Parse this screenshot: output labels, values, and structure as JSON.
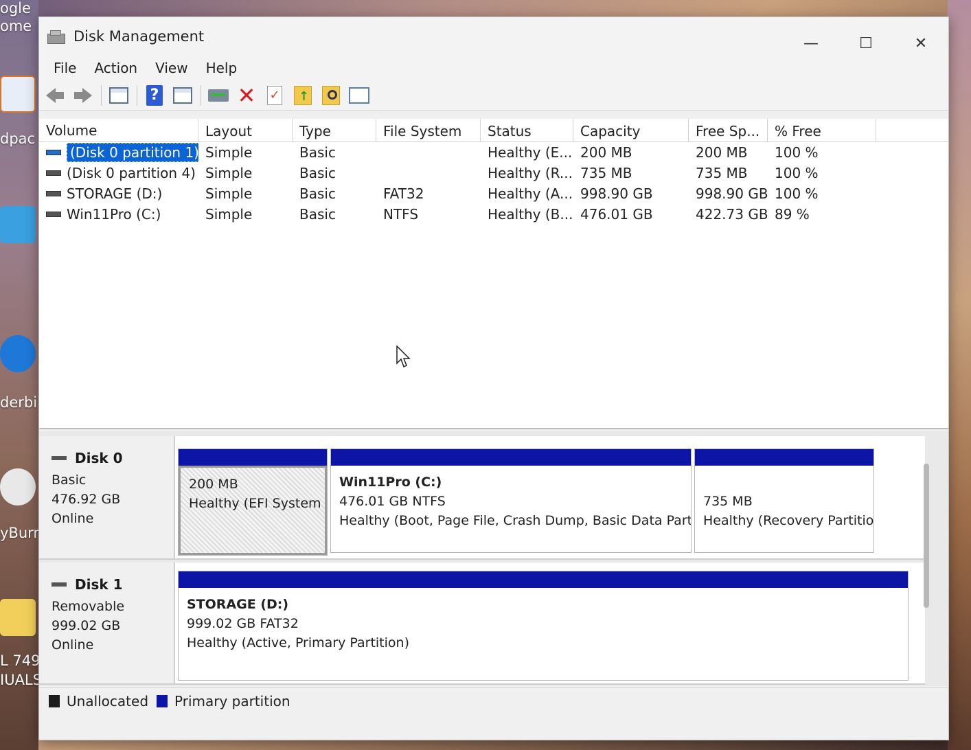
{
  "desktop": {
    "labels": [
      "ogle",
      "ome",
      "dpac",
      "derbi",
      "yBurn",
      "L 749(",
      "IUALS"
    ]
  },
  "window": {
    "title": "Disk Management",
    "controls": [
      "—",
      "☐",
      "✕"
    ]
  },
  "menu": [
    "File",
    "Action",
    "View",
    "Help"
  ],
  "columns": [
    "Volume",
    "Layout",
    "Type",
    "File System",
    "Status",
    "Capacity",
    "Free Sp...",
    "% Free"
  ],
  "volumes": [
    {
      "volume": "(Disk 0 partition 1)",
      "layout": "Simple",
      "type": "Basic",
      "fs": "",
      "status": "Healthy (E...",
      "capacity": "200 MB",
      "free": "200 MB",
      "pct": "100 %"
    },
    {
      "volume": "(Disk 0 partition 4)",
      "layout": "Simple",
      "type": "Basic",
      "fs": "",
      "status": "Healthy (R...",
      "capacity": "735 MB",
      "free": "735 MB",
      "pct": "100 %"
    },
    {
      "volume": "STORAGE (D:)",
      "layout": "Simple",
      "type": "Basic",
      "fs": "FAT32",
      "status": "Healthy (A...",
      "capacity": "998.90 GB",
      "free": "998.90 GB",
      "pct": "100 %"
    },
    {
      "volume": "Win11Pro (C:)",
      "layout": "Simple",
      "type": "Basic",
      "fs": "NTFS",
      "status": "Healthy (B...",
      "capacity": "476.01 GB",
      "free": "422.73 GB",
      "pct": "89 %"
    }
  ],
  "disks": [
    {
      "name": "Disk 0",
      "kind": "Basic",
      "size": "476.92 GB",
      "state": "Online",
      "partitions": [
        {
          "name": "",
          "size": "200 MB",
          "status": "Healthy (EFI System"
        },
        {
          "name": "Win11Pro  (C:)",
          "size": "476.01 GB NTFS",
          "status": "Healthy (Boot, Page File, Crash Dump, Basic Data Partit"
        },
        {
          "name": "",
          "size": "735 MB",
          "status": "Healthy (Recovery Partitio"
        }
      ]
    },
    {
      "name": "Disk 1",
      "kind": "Removable",
      "size": "999.02 GB",
      "state": "Online",
      "partitions": [
        {
          "name": "STORAGE  (D:)",
          "size": "999.02 GB FAT32",
          "status": "Healthy (Active, Primary Partition)"
        }
      ]
    }
  ],
  "legend": {
    "unallocated": "Unallocated",
    "primary": "Primary partition",
    "colors": {
      "unallocated": "#1c1c1c",
      "primary": "#0c15a6"
    }
  }
}
